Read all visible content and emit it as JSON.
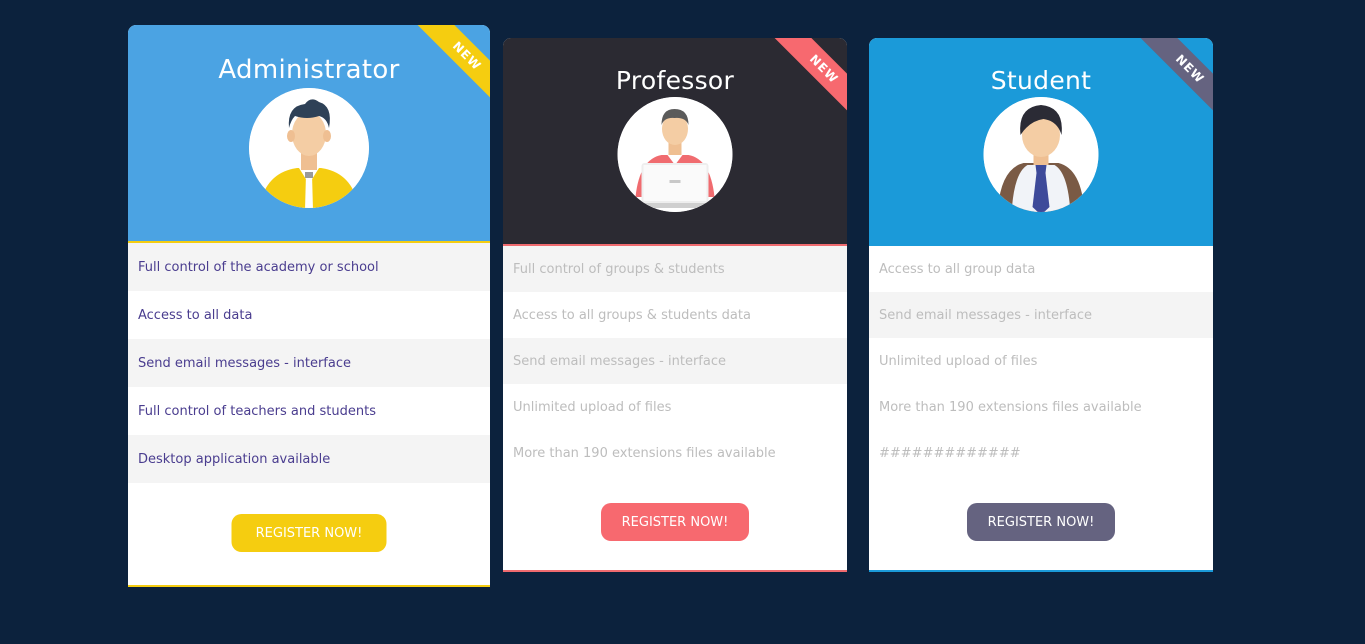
{
  "colors": {
    "background": "#0c223d",
    "admin_header": "#4ba3e3",
    "admin_accent": "#f5cd10",
    "professor_header": "#2b2a32",
    "professor_accent": "#f7696f",
    "student_header": "#1b9ad9",
    "student_accent": "#656380"
  },
  "cards": [
    {
      "title": "Administrator",
      "ribbon": "NEW",
      "avatar_icon": "administrator-avatar-icon",
      "features": [
        "Full control of the academy or school",
        "Access to all data",
        "Send email messages - interface",
        "Full control of teachers and students",
        "Desktop application available"
      ],
      "button": "REGISTER NOW!"
    },
    {
      "title": "Professor",
      "ribbon": "NEW",
      "avatar_icon": "professor-avatar-icon",
      "features": [
        "Full control of groups & students",
        "Access to all groups & students data",
        "Send email messages - interface",
        "Unlimited upload of files",
        "More than 190 extensions files available"
      ],
      "button": "REGISTER NOW!"
    },
    {
      "title": "Student",
      "ribbon": "NEW",
      "avatar_icon": "student-avatar-icon",
      "features": [
        "Access to all group data",
        "Send email messages - interface",
        "Unlimited upload of files",
        "More than 190 extensions files available",
        "#############"
      ],
      "button": "REGISTER NOW!"
    }
  ]
}
